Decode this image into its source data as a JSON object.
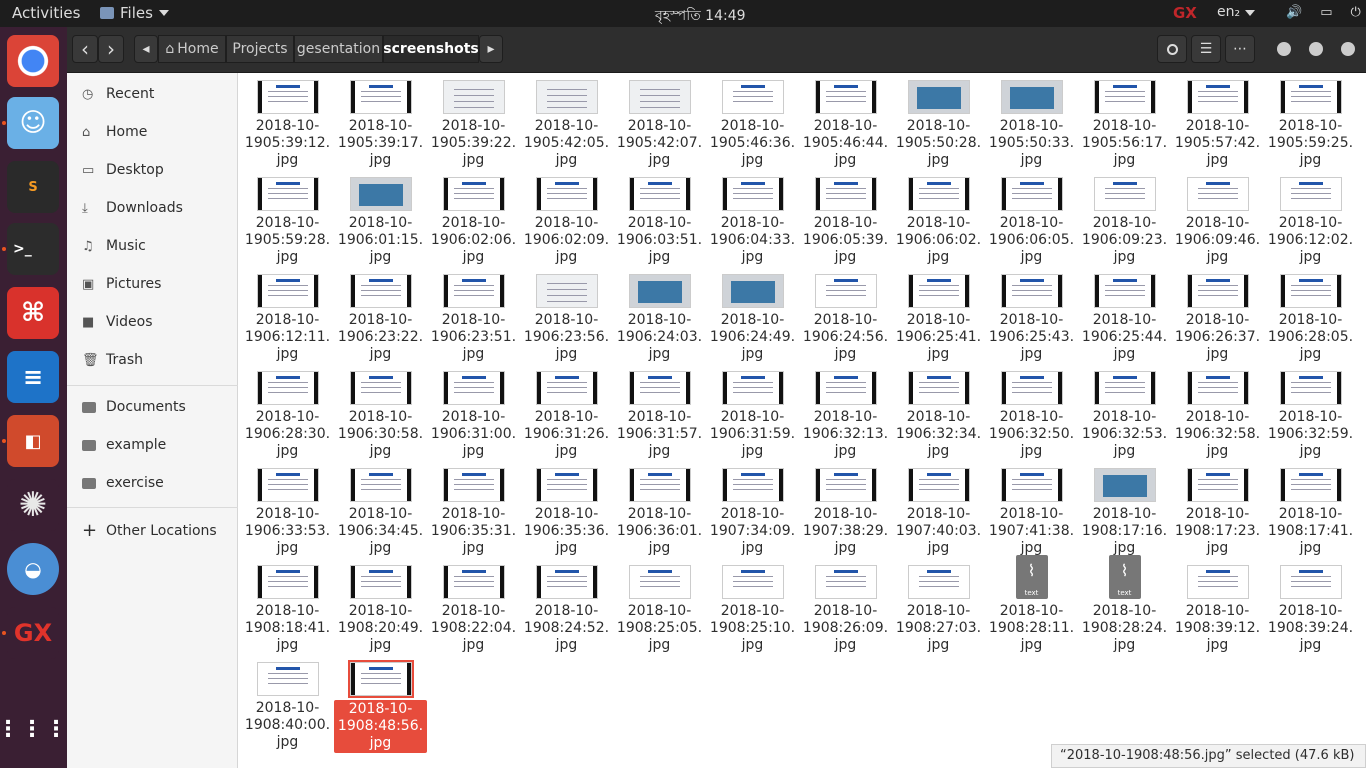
{
  "topbar": {
    "activities": "Activities",
    "app": "Files",
    "clock": "বৃহস্পতি 14:49",
    "gx": "GX",
    "lang": "en₂"
  },
  "toolbar": {
    "back": "‹",
    "forward": "›",
    "left": "◂",
    "right": "▸"
  },
  "breadcrumbs": [
    "Home",
    "Projects",
    "gesentation",
    "screenshots"
  ],
  "sidebar": {
    "places": [
      "Recent",
      "Home",
      "Desktop",
      "Downloads",
      "Music",
      "Pictures",
      "Videos",
      "Trash"
    ],
    "bookmarks": [
      "Documents",
      "example",
      "exercise"
    ],
    "other": "Other Locations"
  },
  "files": [
    [
      "2018-10-\n1905:39:12.\njpg",
      "slide"
    ],
    [
      "2018-10-\n1905:39:17.\njpg",
      "slide"
    ],
    [
      "2018-10-\n1905:39:22.\njpg",
      "grey"
    ],
    [
      "2018-10-\n1905:42:05.\njpg",
      "grey"
    ],
    [
      "2018-10-\n1905:42:07.\njpg",
      "grey"
    ],
    [
      "2018-10-\n1905:46:36.\njpg",
      "white"
    ],
    [
      "2018-10-\n1905:46:44.\njpg",
      "slide"
    ],
    [
      "2018-10-\n1905:50:28.\njpg",
      "screen"
    ],
    [
      "2018-10-\n1905:50:33.\njpg",
      "screen"
    ],
    [
      "2018-10-\n1905:56:17.\njpg",
      "slide"
    ],
    [
      "2018-10-\n1905:57:42.\njpg",
      "slide"
    ],
    [
      "2018-10-\n1905:59:25.\njpg",
      "slide"
    ],
    [
      "2018-10-\n1905:59:28.\njpg",
      "slide"
    ],
    [
      "2018-10-\n1906:01:15.\njpg",
      "screen"
    ],
    [
      "2018-10-\n1906:02:06.\njpg",
      "slide"
    ],
    [
      "2018-10-\n1906:02:09.\njpg",
      "slide"
    ],
    [
      "2018-10-\n1906:03:51.\njpg",
      "slide"
    ],
    [
      "2018-10-\n1906:04:33.\njpg",
      "slide"
    ],
    [
      "2018-10-\n1906:05:39.\njpg",
      "slide"
    ],
    [
      "2018-10-\n1906:06:02.\njpg",
      "slide"
    ],
    [
      "2018-10-\n1906:06:05.\njpg",
      "slide"
    ],
    [
      "2018-10-\n1906:09:23.\njpg",
      "white"
    ],
    [
      "2018-10-\n1906:09:46.\njpg",
      "white"
    ],
    [
      "2018-10-\n1906:12:02.\njpg",
      "white"
    ],
    [
      "2018-10-\n1906:12:11.\njpg",
      "slide"
    ],
    [
      "2018-10-\n1906:23:22.\njpg",
      "slide"
    ],
    [
      "2018-10-\n1906:23:51.\njpg",
      "slide"
    ],
    [
      "2018-10-\n1906:23:56.\njpg",
      "grey"
    ],
    [
      "2018-10-\n1906:24:03.\njpg",
      "screen"
    ],
    [
      "2018-10-\n1906:24:49.\njpg",
      "screen"
    ],
    [
      "2018-10-\n1906:24:56.\njpg",
      "white"
    ],
    [
      "2018-10-\n1906:25:41.\njpg",
      "slide"
    ],
    [
      "2018-10-\n1906:25:43.\njpg",
      "slide"
    ],
    [
      "2018-10-\n1906:25:44.\njpg",
      "slide"
    ],
    [
      "2018-10-\n1906:26:37.\njpg",
      "slide"
    ],
    [
      "2018-10-\n1906:28:05.\njpg",
      "slide"
    ],
    [
      "2018-10-\n1906:28:30.\njpg",
      "slide"
    ],
    [
      "2018-10-\n1906:30:58.\njpg",
      "slide"
    ],
    [
      "2018-10-\n1906:31:00.\njpg",
      "slide"
    ],
    [
      "2018-10-\n1906:31:26.\njpg",
      "slide"
    ],
    [
      "2018-10-\n1906:31:57.\njpg",
      "slide"
    ],
    [
      "2018-10-\n1906:31:59.\njpg",
      "slide"
    ],
    [
      "2018-10-\n1906:32:13.\njpg",
      "slide"
    ],
    [
      "2018-10-\n1906:32:34.\njpg",
      "slide"
    ],
    [
      "2018-10-\n1906:32:50.\njpg",
      "slide"
    ],
    [
      "2018-10-\n1906:32:53.\njpg",
      "slide"
    ],
    [
      "2018-10-\n1906:32:58.\njpg",
      "slide"
    ],
    [
      "2018-10-\n1906:32:59.\njpg",
      "slide"
    ],
    [
      "2018-10-\n1906:33:53.\njpg",
      "slide"
    ],
    [
      "2018-10-\n1906:34:45.\njpg",
      "slide"
    ],
    [
      "2018-10-\n1906:35:31.\njpg",
      "slide"
    ],
    [
      "2018-10-\n1906:35:36.\njpg",
      "slide"
    ],
    [
      "2018-10-\n1906:36:01.\njpg",
      "slide"
    ],
    [
      "2018-10-\n1907:34:09.\njpg",
      "slide"
    ],
    [
      "2018-10-\n1907:38:29.\njpg",
      "slide"
    ],
    [
      "2018-10-\n1907:40:03.\njpg",
      "slide"
    ],
    [
      "2018-10-\n1907:41:38.\njpg",
      "slide"
    ],
    [
      "2018-10-\n1908:17:16.\njpg",
      "screen"
    ],
    [
      "2018-10-\n1908:17:23.\njpg",
      "slide"
    ],
    [
      "2018-10-\n1908:17:41.\njpg",
      "slide"
    ],
    [
      "2018-10-\n1908:18:41.\njpg",
      "slide"
    ],
    [
      "2018-10-\n1908:20:49.\njpg",
      "slide"
    ],
    [
      "2018-10-\n1908:22:04.\njpg",
      "slide"
    ],
    [
      "2018-10-\n1908:24:52.\njpg",
      "slide"
    ],
    [
      "2018-10-\n1908:25:05.\njpg",
      "white"
    ],
    [
      "2018-10-\n1908:25:10.\njpg",
      "white"
    ],
    [
      "2018-10-\n1908:26:09.\njpg",
      "white"
    ],
    [
      "2018-10-\n1908:27:03.\njpg",
      "white"
    ],
    [
      "2018-10-\n1908:28:11.\njpg",
      "text"
    ],
    [
      "2018-10-\n1908:28:24.\njpg",
      "text"
    ],
    [
      "2018-10-\n1908:39:12.\njpg",
      "white"
    ],
    [
      "2018-10-\n1908:39:24.\njpg",
      "white"
    ],
    [
      "2018-10-\n1908:40:00.\njpg",
      "white"
    ],
    [
      "2018-10-\n1908:48:56.\njpg",
      "slide"
    ]
  ],
  "text_icon_label": "text",
  "selected_index": 73,
  "status": "“2018-10-1908:48:56.jpg” selected  (47.6 kB)",
  "colors": {
    "selection": "#e74c3c",
    "dock": "#3a1f33"
  }
}
